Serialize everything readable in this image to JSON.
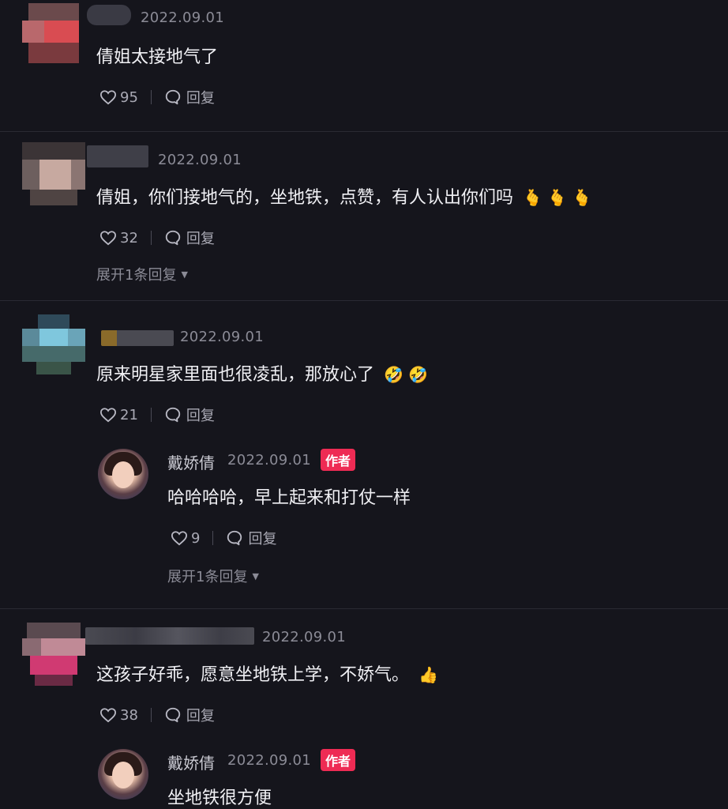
{
  "comments": [
    {
      "date": "2022.09.01",
      "text": "倩姐太接地气了",
      "emoji": "",
      "likes": "95",
      "reply_label": "回复"
    },
    {
      "date": "2022.09.01",
      "text": "倩姐，你们接地气的，坐地铁，点赞，有人认出你们吗",
      "emoji": "🫰 🫰 🫰",
      "likes": "32",
      "reply_label": "回复",
      "expand_label": "展开1条回复"
    },
    {
      "date": "2022.09.01",
      "text": "原来明星家里面也很凌乱，那放心了",
      "emoji": "🤣 🤣",
      "likes": "21",
      "reply_label": "回复",
      "author_reply": {
        "name": "戴娇倩",
        "date": "2022.09.01",
        "badge": "作者",
        "text": "哈哈哈哈，早上起来和打仗一样",
        "likes": "9",
        "reply_label": "回复",
        "expand_label": "展开1条回复"
      }
    },
    {
      "date": "2022.09.01",
      "text": "这孩子好乖，愿意坐地铁上学，不娇气。",
      "emoji": "👍",
      "likes": "38",
      "reply_label": "回复",
      "author_reply": {
        "name": "戴娇倩",
        "date": "2022.09.01",
        "badge": "作者",
        "text": "坐地铁很方便"
      }
    }
  ],
  "colors": {
    "background": "#15151c",
    "badge": "#ee2b54",
    "muted": "#8b8b96"
  },
  "icons": {
    "like": "heart-icon",
    "reply": "chat-bubble-icon",
    "expand": "caret-down-icon"
  }
}
